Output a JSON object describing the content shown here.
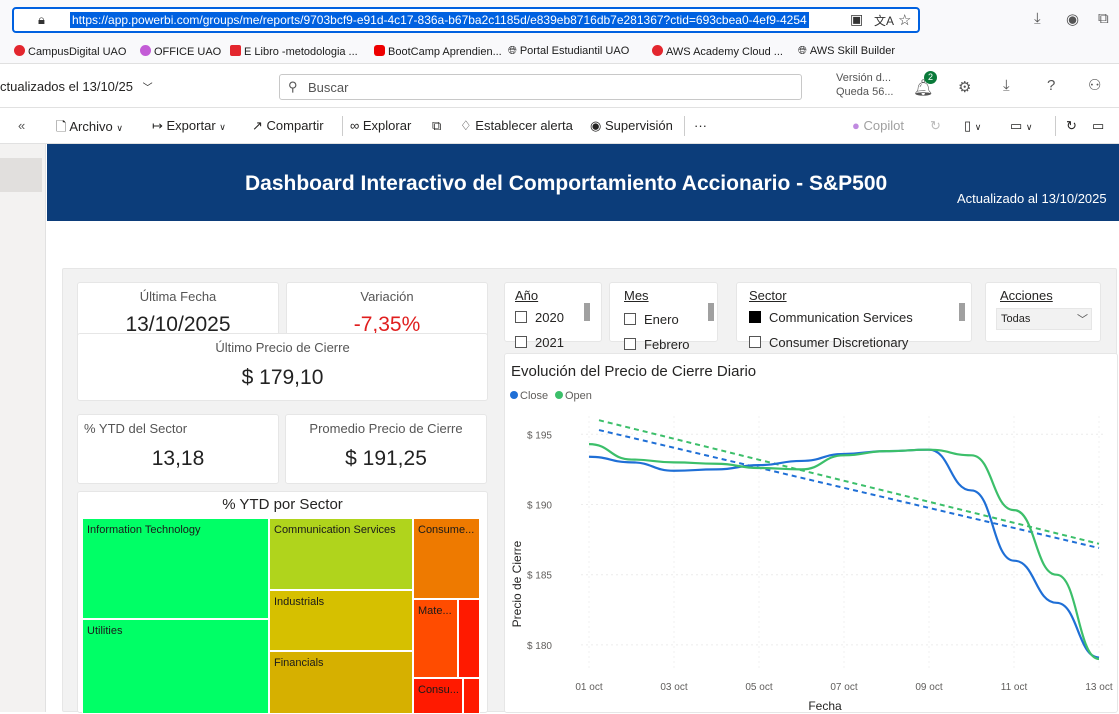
{
  "browser": {
    "url": "https://app.powerbi.com/groups/me/reports/9703bcf9-e91d-4c17-836a-b67ba2c1185d/e839eb8716db7e281367?ctid=693cbea0-4ef9-4254",
    "bookmarks": [
      "CampusDigital UAO",
      "OFFICE UAO",
      "E Libro -metodologia ...",
      "BootCamp Aprendien...",
      "Portal Estudiantil UAO",
      "AWS Academy Cloud ...",
      "AWS Skill Builder"
    ]
  },
  "pbi": {
    "breadcrumb": "ctualizados el 13/10/25",
    "search_placeholder": "Buscar",
    "version_line1": "Versión d...",
    "version_line2": "Queda 56...",
    "notif_count": "2"
  },
  "toolbar": {
    "archivo": "Archivo",
    "exportar": "Exportar",
    "compartir": "Compartir",
    "explorar": "Explorar",
    "alerta": "Establecer alerta",
    "supervision": "Supervisión",
    "more": "···",
    "copilot": "Copilot"
  },
  "header": {
    "title": "Dashboard Interactivo del Comportamiento Accionario - S&P500",
    "updated": "Actualizado al 13/10/2025"
  },
  "kpis": {
    "ultima_fecha_label": "Última Fecha",
    "ultima_fecha_value": "13/10/2025",
    "variacion_label": "Variación",
    "variacion_value": "-7,35%",
    "precio_cierre_label": "Último Precio de Cierre",
    "precio_cierre_value": "$ 179,10",
    "ytd_sector_label": "% YTD del Sector",
    "ytd_sector_value": "13,18",
    "promedio_label": "Promedio Precio de Cierre",
    "promedio_value": "$ 191,25"
  },
  "slicers": {
    "anio": {
      "label": "Año",
      "options": [
        "2020",
        "2021"
      ]
    },
    "mes": {
      "label": "Mes",
      "options": [
        "Enero",
        "Febrero"
      ]
    },
    "sector": {
      "label": "Sector",
      "options": [
        "Communication Services",
        "Consumer Discretionary"
      ],
      "selected": "Communication Services"
    },
    "acciones": {
      "label": "Acciones",
      "value": "Todas"
    }
  },
  "treemap": {
    "title": "% YTD por Sector",
    "items": [
      {
        "label": "Information Technology",
        "color": "#00ff66"
      },
      {
        "label": "Utilities",
        "color": "#00ff66"
      },
      {
        "label": "Communication Services",
        "color": "#b0d41c"
      },
      {
        "label": "Industrials",
        "color": "#d6c000"
      },
      {
        "label": "Financials",
        "color": "#d6b000"
      },
      {
        "label": "Consume...",
        "color": "#ee7a00"
      },
      {
        "label": "Mate...",
        "color": "#ff4c00"
      },
      {
        "label": "Consu...",
        "color": "#ff1a00"
      }
    ]
  },
  "chart_data": {
    "type": "line",
    "title": "Evolución del Precio de Cierre Diario",
    "xlabel": "Fecha",
    "ylabel": "Precio de Cierre",
    "x": [
      "01 oct",
      "02 oct",
      "03 oct",
      "04 oct",
      "05 oct",
      "06 oct",
      "07 oct",
      "08 oct",
      "09 oct",
      "10 oct",
      "11 oct",
      "12 oct",
      "13 oct"
    ],
    "x_ticks": [
      "01 oct",
      "03 oct",
      "05 oct",
      "07 oct",
      "09 oct",
      "11 oct",
      "13 oct"
    ],
    "y_ticks": [
      "$ 180",
      "$ 185",
      "$ 190",
      "$ 195"
    ],
    "ylim": [
      178.5,
      196.3
    ],
    "legend_position": "top-left",
    "series": [
      {
        "name": "Close",
        "color": "#1f6fd6",
        "values": [
          193.4,
          193.0,
          192.4,
          192.5,
          192.8,
          193.1,
          193.6,
          193.8,
          193.9,
          191.0,
          186.0,
          183.0,
          179.1
        ]
      },
      {
        "name": "Open",
        "color": "#3cbf6a",
        "values": [
          194.3,
          193.2,
          193.0,
          192.9,
          192.6,
          192.5,
          193.5,
          193.8,
          193.9,
          193.5,
          189.6,
          185.0,
          179.0
        ]
      }
    ],
    "trendlines": [
      {
        "series": "Close",
        "start": 195.3,
        "end": 186.9
      },
      {
        "series": "Open",
        "start": 196.0,
        "end": 187.2
      }
    ]
  }
}
